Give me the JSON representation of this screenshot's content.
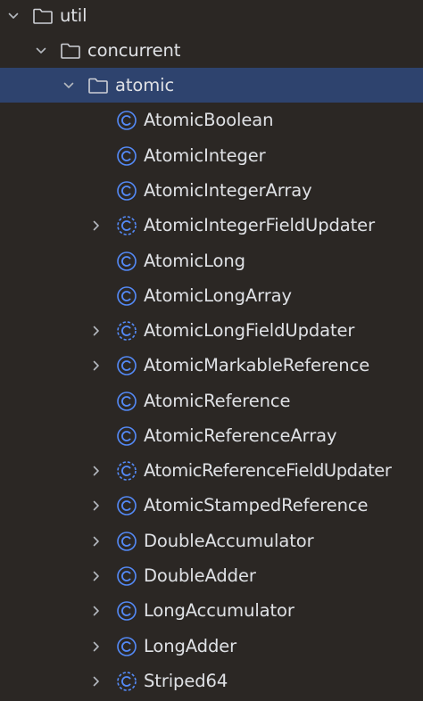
{
  "tree": {
    "folders": [
      {
        "label": "util",
        "icon": "folder-icon",
        "expanded": true
      },
      {
        "label": "concurrent",
        "icon": "folder-icon",
        "expanded": true
      },
      {
        "label": "atomic",
        "icon": "folder-icon",
        "expanded": true,
        "selected": true
      }
    ],
    "classes": [
      {
        "label": "AtomicBoolean",
        "icon": "class-icon",
        "expandable": false
      },
      {
        "label": "AtomicInteger",
        "icon": "class-icon",
        "expandable": false
      },
      {
        "label": "AtomicIntegerArray",
        "icon": "class-icon",
        "expandable": false
      },
      {
        "label": "AtomicIntegerFieldUpdater",
        "icon": "abstract-class-icon",
        "expandable": true
      },
      {
        "label": "AtomicLong",
        "icon": "class-icon",
        "expandable": false
      },
      {
        "label": "AtomicLongArray",
        "icon": "class-icon",
        "expandable": false
      },
      {
        "label": "AtomicLongFieldUpdater",
        "icon": "abstract-class-icon",
        "expandable": true
      },
      {
        "label": "AtomicMarkableReference",
        "icon": "class-icon",
        "expandable": true
      },
      {
        "label": "AtomicReference",
        "icon": "class-icon",
        "expandable": false
      },
      {
        "label": "AtomicReferenceArray",
        "icon": "class-icon",
        "expandable": false
      },
      {
        "label": "AtomicReferenceFieldUpdater",
        "icon": "abstract-class-icon",
        "expandable": true
      },
      {
        "label": "AtomicStampedReference",
        "icon": "class-icon",
        "expandable": true
      },
      {
        "label": "DoubleAccumulator",
        "icon": "class-icon",
        "expandable": true
      },
      {
        "label": "DoubleAdder",
        "icon": "class-icon",
        "expandable": true
      },
      {
        "label": "LongAccumulator",
        "icon": "class-icon",
        "expandable": true
      },
      {
        "label": "LongAdder",
        "icon": "class-icon",
        "expandable": true
      },
      {
        "label": "Striped64",
        "icon": "abstract-class-icon",
        "expandable": true
      }
    ]
  },
  "colors": {
    "background": "#2b2724",
    "selection": "#2e436e",
    "text": "#dfe1e5",
    "class_icon": "#548af7",
    "chevron": "#b4b8bf"
  }
}
